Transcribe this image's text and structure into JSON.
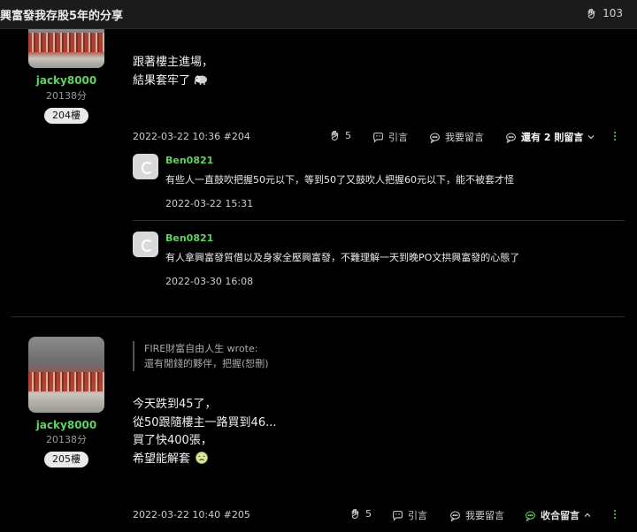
{
  "header": {
    "title": "興富發我存股5年的分享",
    "like_count": "103"
  },
  "posts": [
    {
      "username": "jacky8000",
      "score": "20138分",
      "floor": "204樓",
      "lines": [
        "跟著樓主進場，",
        "結果套牢了"
      ],
      "emoji": "elephant-icon",
      "datetime": "2022-03-22 10:36 #204",
      "like_count": "5",
      "quote_label": "引言",
      "reply_label": "我要留言",
      "more_replies_label": "還有 2 則留言",
      "comments": [
        {
          "name": "Ben0821",
          "text": "有些人一直鼓吹把握50元以下，等到50了又鼓吹人把握60元以下，能不被套才怪",
          "time": "2022-03-22 15:31"
        },
        {
          "name": "Ben0821",
          "text": "有人拿興富發質借以及身家全壓興富發，不難理解一天到晚PO文拱興富發的心態了",
          "time": "2022-03-30 16:08"
        }
      ]
    },
    {
      "username": "jacky8000",
      "score": "20138分",
      "floor": "205樓",
      "quote_author": "FIRE財富自由人生 wrote:",
      "quote_text": "還有閒錢的夥伴，把握(恕刪)",
      "lines": [
        "今天跌到45了，",
        "從50跟隨樓主一路買到46...",
        "買了快400張，",
        "希望能解套"
      ],
      "emoji": "sick-face-icon",
      "datetime": "2022-03-22 10:40 #205",
      "like_count": "5",
      "quote_label": "引言",
      "reply_label": "我要留言",
      "collapse_label": "收合留言"
    }
  ],
  "colors": {
    "username": "#5fd35f",
    "background": "#000000",
    "topbar": "#1b1b1b"
  }
}
